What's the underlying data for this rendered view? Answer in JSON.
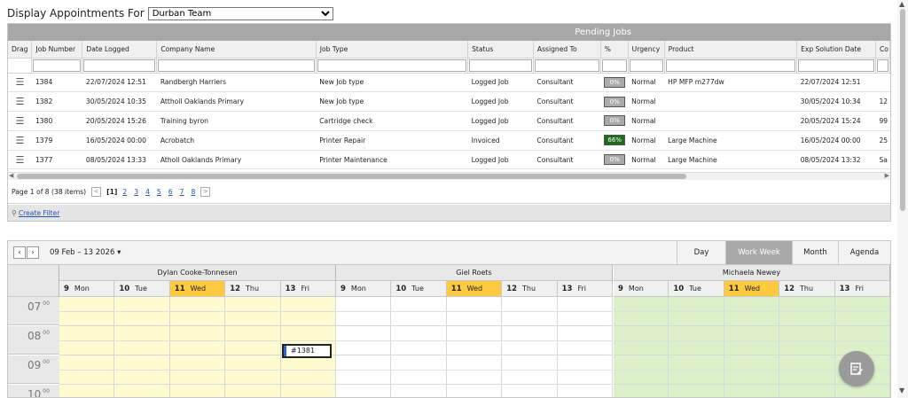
{
  "header": {
    "label": "Display Appointments For",
    "selected_team": "Durban Team"
  },
  "grid": {
    "group_header": "Pending Jobs",
    "columns": [
      "Drag",
      "Job Number",
      "Date Logged",
      "Company Name",
      "Job Type",
      "Status",
      "Assigned To",
      "%",
      "Urgency",
      "Product",
      "Exp Solution Date",
      "Co"
    ],
    "rows": [
      {
        "job": "1384",
        "date": "22/07/2024 12:51",
        "company": "Randbergh Harriers",
        "type": "New Job type",
        "status": "Logged Job",
        "assigned": "Consultant",
        "pct": "0%",
        "urgency": "Normal",
        "product": "HP MFP m277dw",
        "exp": "22/07/2024 12:51",
        "extra": ""
      },
      {
        "job": "1382",
        "date": "30/05/2024 10:35",
        "company": "Attholl Oaklands Primary",
        "type": "New Job type",
        "status": "Logged Job",
        "assigned": "Consultant",
        "pct": "0%",
        "urgency": "Normal",
        "product": "",
        "exp": "30/05/2024 10:34",
        "extra": "12"
      },
      {
        "job": "1380",
        "date": "20/05/2024 15:26",
        "company": "Training byron",
        "type": "Cartridge check",
        "status": "Logged Job",
        "assigned": "Consultant",
        "pct": "0%",
        "urgency": "Normal",
        "product": "",
        "exp": "20/05/2024 15:24",
        "extra": "99"
      },
      {
        "job": "1379",
        "date": "16/05/2024 00:00",
        "company": "Acrobatch",
        "type": "Printer Repair",
        "status": "Invoiced",
        "assigned": "Consultant",
        "pct": "66%",
        "urgency": "Normal",
        "product": "Large Machine",
        "exp": "16/05/2024 00:00",
        "extra": "25"
      },
      {
        "job": "1377",
        "date": "08/05/2024 13:33",
        "company": "Atholl Oaklands Primary",
        "type": "Printer Maintenance",
        "status": "Logged Job",
        "assigned": "Consultant",
        "pct": "0%",
        "urgency": "Normal",
        "product": "Large Machine",
        "exp": "08/05/2024 13:32",
        "extra": "Sa"
      }
    ],
    "progress": [
      0,
      0,
      0,
      66,
      0
    ],
    "pager": {
      "info": "Page 1 of 8 (38 items)",
      "current": "[1]",
      "pages": [
        "2",
        "3",
        "4",
        "5",
        "6",
        "7",
        "8"
      ],
      "prev": "<",
      "next": ">"
    },
    "filter_link": "Create Filter"
  },
  "scheduler": {
    "date_range": "09 Feb – 13 2026",
    "views": [
      "Day",
      "Work Week",
      "Month",
      "Agenda"
    ],
    "active_view": "Work Week",
    "resources": [
      {
        "name": "Dylan Cooke-Tonnesen",
        "color": "#fffbd0"
      },
      {
        "name": "Giel Roets",
        "color": "#ffffff"
      },
      {
        "name": "Michaela Newey",
        "color": "#dcf1c9"
      }
    ],
    "days": [
      {
        "num": "9",
        "name": "Mon"
      },
      {
        "num": "10",
        "name": "Tue"
      },
      {
        "num": "11",
        "name": "Wed"
      },
      {
        "num": "12",
        "name": "Thu"
      },
      {
        "num": "13",
        "name": "Fri"
      }
    ],
    "today_index": 2,
    "hours": [
      {
        "h": "07",
        "m": "00"
      },
      {
        "h": "08",
        "m": "00"
      },
      {
        "h": "09",
        "m": "00"
      },
      {
        "h": "10",
        "m": "00"
      }
    ],
    "event": {
      "label": "#1381"
    }
  },
  "colors": {
    "grid_header": "#a8a8a8",
    "today": "#ffc940",
    "progress_done": "#1e6b1e",
    "progress_empty": "#aaaaaa"
  }
}
